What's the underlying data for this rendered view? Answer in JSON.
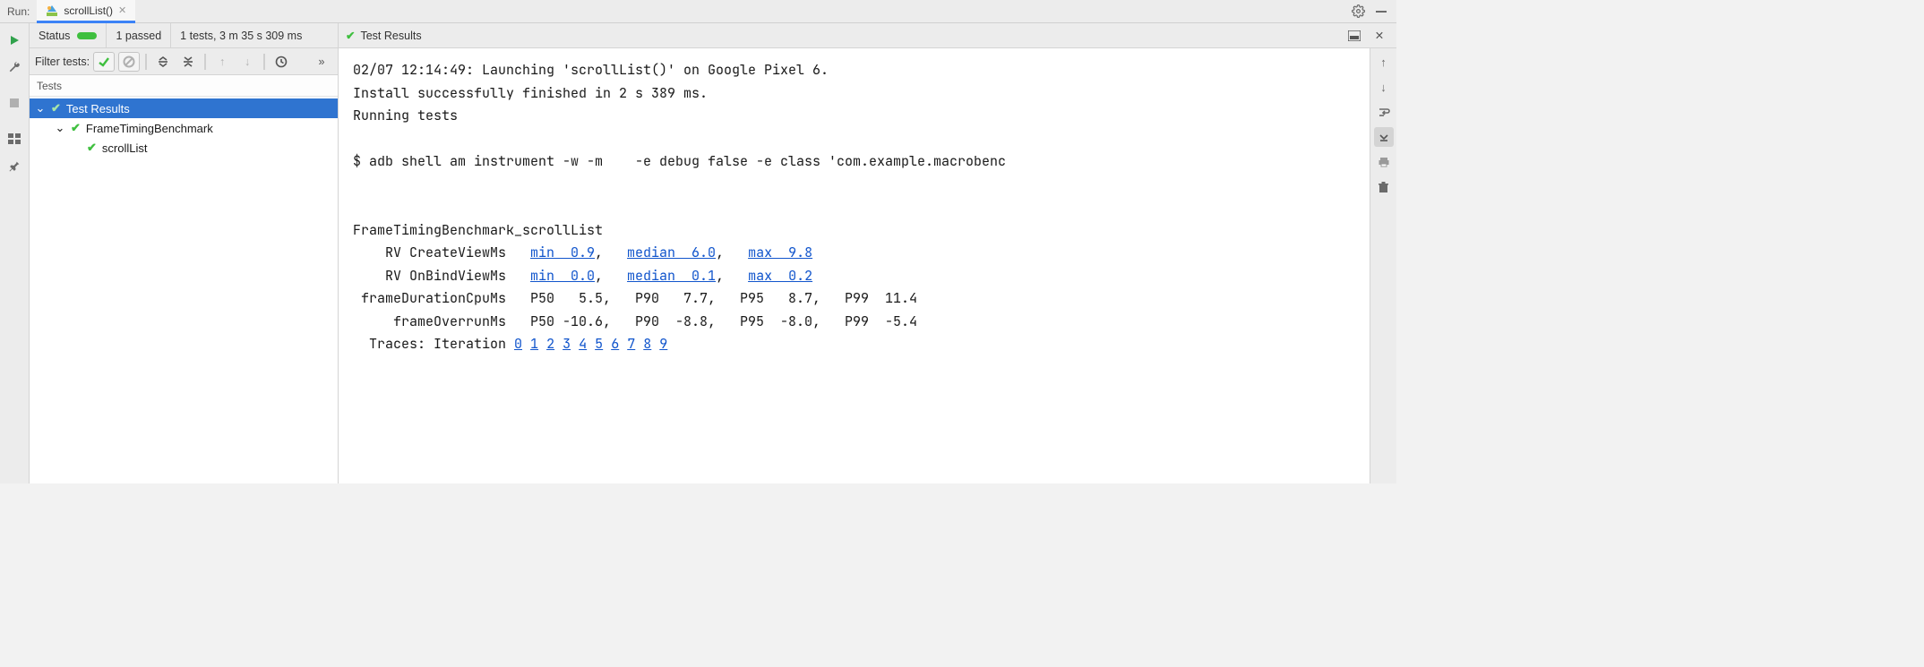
{
  "header": {
    "run_label": "Run:",
    "tab_label": "scrollList()"
  },
  "status": {
    "label": "Status",
    "passed": "1 passed",
    "summary": "1 tests, 3 m 35 s 309 ms"
  },
  "filter": {
    "label": "Filter tests:"
  },
  "tests_header": "Tests",
  "tree": {
    "root": "Test Results",
    "class": "FrameTimingBenchmark",
    "test": "scrollList"
  },
  "console_header": "Test Results",
  "console": {
    "launch_line": "02/07 12:14:49: Launching 'scrollList()' on Google Pixel 6.",
    "install_line": "Install successfully finished in 2 s 389 ms.",
    "running_line": "Running tests",
    "adb_line": "$ adb shell am instrument -w -m    -e debug false -e class 'com.example.macrobenc",
    "bench_title": "FrameTimingBenchmark_scrollList",
    "rv_create_label": "    RV CreateViewMs   ",
    "rv_create_min": "min  0.9",
    "rv_create_sep1": ",   ",
    "rv_create_median": "median  6.0",
    "rv_create_sep2": ",   ",
    "rv_create_max": "max  9.8",
    "rv_bind_label": "    RV OnBindViewMs   ",
    "rv_bind_min": "min  0.0",
    "rv_bind_sep1": ",   ",
    "rv_bind_median": "median  0.1",
    "rv_bind_sep2": ",   ",
    "rv_bind_max": "max  0.2",
    "frame_cpu_line": " frameDurationCpuMs   P50   5.5,   P90   7.7,   P95   8.7,   P99  11.4",
    "frame_overrun_line": "     frameOverrunMs   P50 -10.6,   P90  -8.8,   P95  -8.0,   P99  -5.4",
    "traces_label": "  Traces: Iteration ",
    "traces": [
      "0",
      "1",
      "2",
      "3",
      "4",
      "5",
      "6",
      "7",
      "8",
      "9"
    ]
  }
}
